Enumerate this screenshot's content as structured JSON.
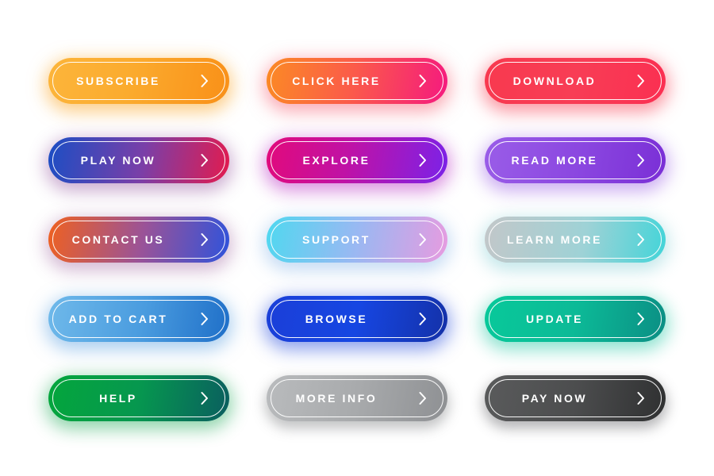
{
  "page": {
    "title": "Gradient Call-To-Action Button Set",
    "background_color": "#ffffff",
    "columns": 3,
    "rows": 5
  },
  "icons": {
    "chevron_right": "chevron-right-icon"
  },
  "buttons": [
    {
      "label": "SUBSCRIBE",
      "name": "subscribe-button",
      "skin": "sk-subscribe",
      "gradient_from": "#fcb53b",
      "gradient_to": "#f99018",
      "text_color": "#ffffff"
    },
    {
      "label": "CLICK HERE",
      "name": "click-here-button",
      "skin": "sk-clickhere",
      "gradient_from": "#fb8b24",
      "gradient_to": "#f5197f",
      "text_color": "#ffffff"
    },
    {
      "label": "DOWNLOAD",
      "name": "download-button",
      "skin": "sk-download",
      "gradient_from": "#f8394f",
      "gradient_to": "#fb2f52",
      "text_color": "#ffffff"
    },
    {
      "label": "PLAY NOW",
      "name": "play-now-button",
      "skin": "sk-playnow",
      "gradient_from": "#1b4ec4",
      "gradient_to": "#e31b4e",
      "text_color": "#ffffff"
    },
    {
      "label": "EXPLORE",
      "name": "explore-button",
      "skin": "sk-explore",
      "gradient_from": "#e20a7b",
      "gradient_to": "#7b22e8",
      "text_color": "#ffffff"
    },
    {
      "label": "READ MORE",
      "name": "read-more-button",
      "skin": "sk-readmore",
      "gradient_from": "#9a5de8",
      "gradient_to": "#7a2fd6",
      "text_color": "#ffffff"
    },
    {
      "label": "CONTACT US",
      "name": "contact-us-button",
      "skin": "sk-contactus",
      "gradient_from": "#ef6120",
      "gradient_to": "#2f53db",
      "text_color": "#ffffff"
    },
    {
      "label": "SUPPORT",
      "name": "support-button",
      "skin": "sk-support",
      "gradient_from": "#4fd8f0",
      "gradient_to": "#e79be0",
      "text_color": "#ffffff"
    },
    {
      "label": "LEARN MORE",
      "name": "learn-more-button",
      "skin": "sk-learnmore",
      "gradient_from": "#c3c7c9",
      "gradient_to": "#42d4d8",
      "text_color": "#ffffff"
    },
    {
      "label": "ADD TO CART",
      "name": "add-to-cart-button",
      "skin": "sk-addtocart",
      "gradient_from": "#6fb9ea",
      "gradient_to": "#1f6fc8",
      "text_color": "#ffffff"
    },
    {
      "label": "BROWSE",
      "name": "browse-button",
      "skin": "sk-browse",
      "gradient_from": "#1b3fd8",
      "gradient_to": "#1431a8",
      "text_color": "#ffffff"
    },
    {
      "label": "UPDATE",
      "name": "update-button",
      "skin": "sk-update",
      "gradient_from": "#08c99a",
      "gradient_to": "#0b8e84",
      "text_color": "#ffffff"
    },
    {
      "label": "HELP",
      "name": "help-button",
      "skin": "sk-help",
      "gradient_from": "#04a63c",
      "gradient_to": "#0a5e5f",
      "text_color": "#ffffff"
    },
    {
      "label": "MORE INFO",
      "name": "more-info-button",
      "skin": "sk-moreinfo",
      "gradient_from": "#b9bbbd",
      "gradient_to": "#8e9093",
      "text_color": "#ffffff"
    },
    {
      "label": "PAY NOW",
      "name": "pay-now-button",
      "skin": "sk-paynow",
      "gradient_from": "#5a5b5c",
      "gradient_to": "#2f3031",
      "text_color": "#ffffff"
    }
  ]
}
